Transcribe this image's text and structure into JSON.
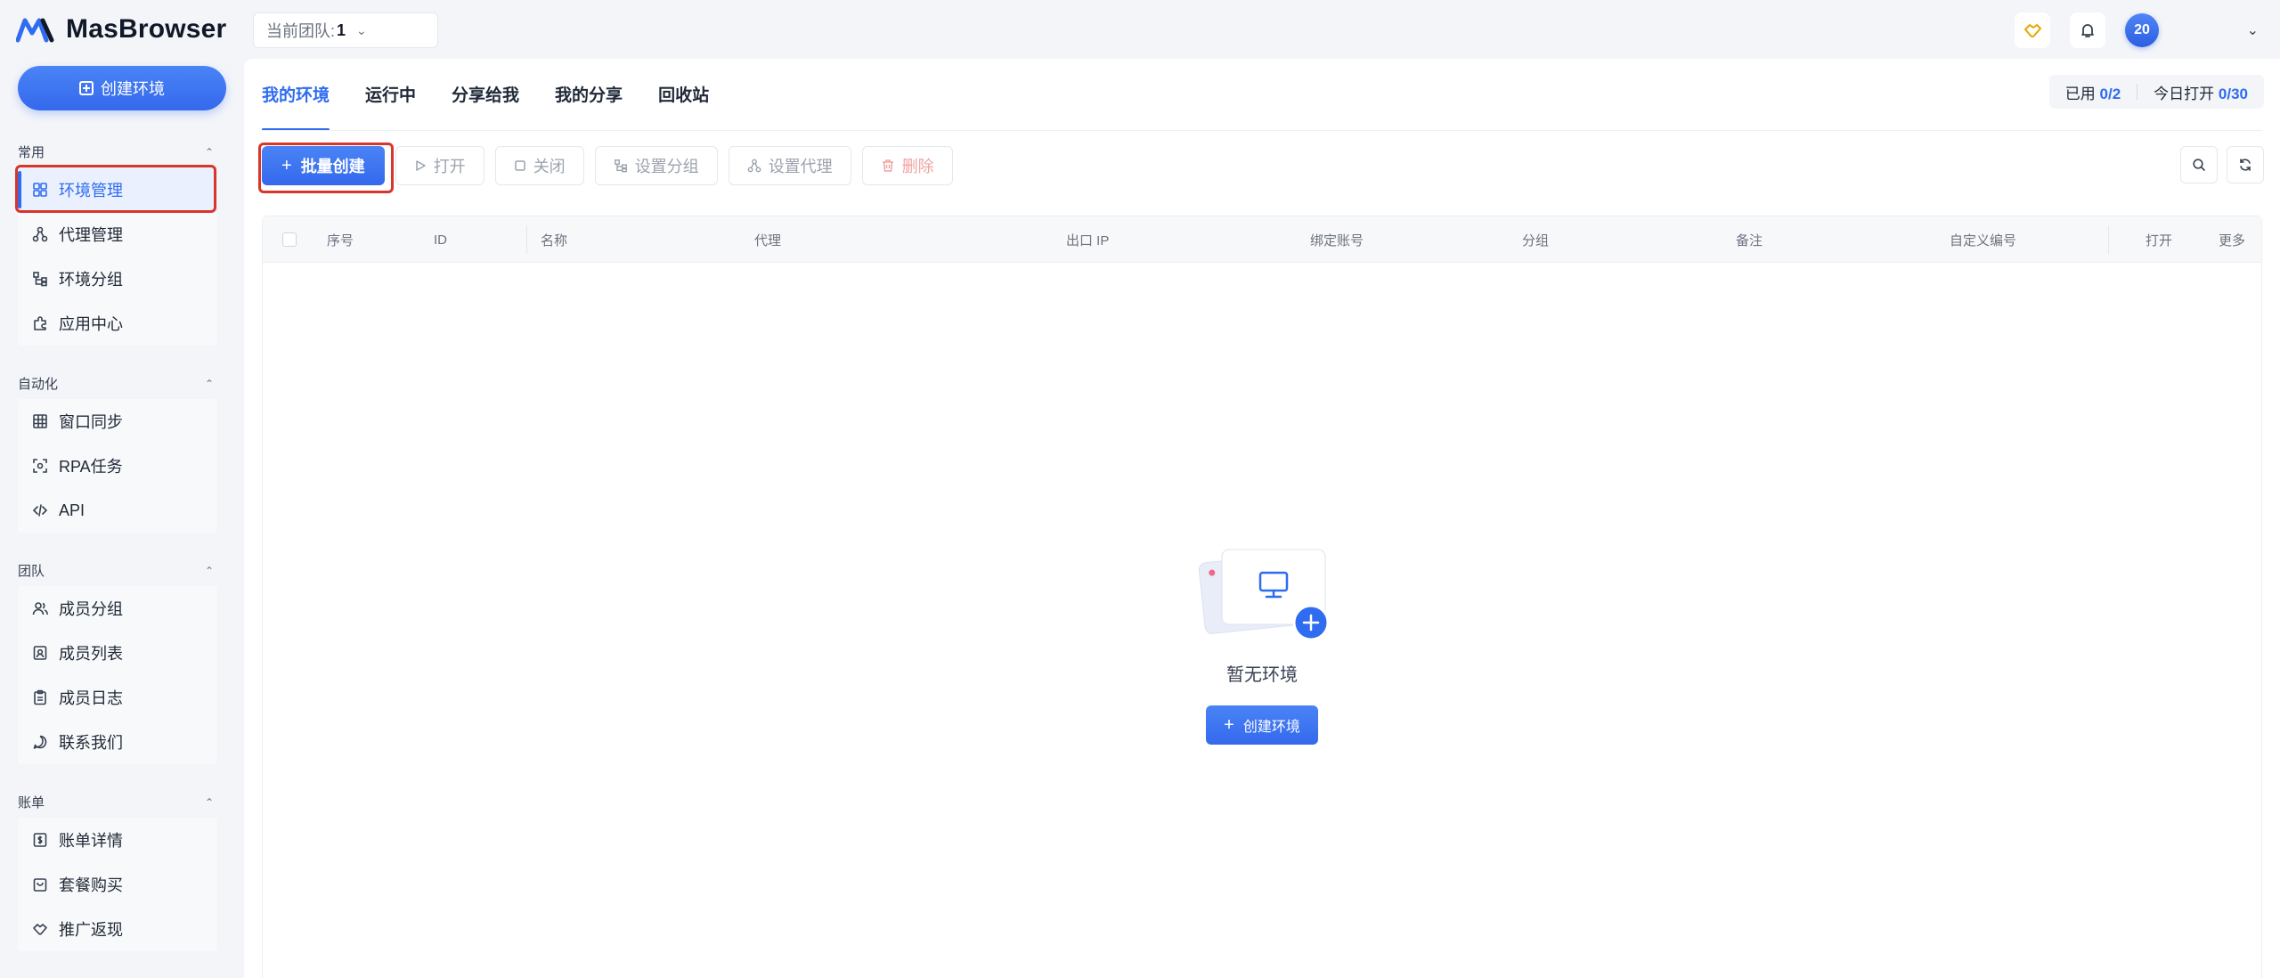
{
  "brand": {
    "name": "MasBrowser"
  },
  "team": {
    "label": "当前团队: ",
    "value": "1"
  },
  "user": {
    "avatar_text": "20"
  },
  "sidebar": {
    "create_label": "创建环境",
    "sections": [
      {
        "title": "常用",
        "items": [
          {
            "label": "环境管理",
            "icon": "grid-icon"
          },
          {
            "label": "代理管理",
            "icon": "network-icon"
          },
          {
            "label": "环境分组",
            "icon": "tree-icon"
          },
          {
            "label": "应用中心",
            "icon": "puzzle-icon"
          }
        ]
      },
      {
        "title": "自动化",
        "items": [
          {
            "label": "窗口同步",
            "icon": "table-icon"
          },
          {
            "label": "RPA任务",
            "icon": "scan-icon"
          },
          {
            "label": "API",
            "icon": "code-icon"
          }
        ]
      },
      {
        "title": "团队",
        "items": [
          {
            "label": "成员分组",
            "icon": "users-icon"
          },
          {
            "label": "成员列表",
            "icon": "contact-icon"
          },
          {
            "label": "成员日志",
            "icon": "clipboard-icon"
          },
          {
            "label": "联系我们",
            "icon": "chat-icon"
          }
        ]
      },
      {
        "title": "账单",
        "items": [
          {
            "label": "账单详情",
            "icon": "dollar-icon"
          },
          {
            "label": "套餐购买",
            "icon": "bag-icon"
          },
          {
            "label": "推广返现",
            "icon": "handshake-icon"
          }
        ]
      }
    ]
  },
  "tabs": [
    "我的环境",
    "运行中",
    "分享给我",
    "我的分享",
    "回收站"
  ],
  "usage": {
    "used_label": "已用",
    "used_value": "0/2",
    "today_label": "今日打开",
    "today_value": "0/30"
  },
  "toolbar": {
    "batch_create": "批量创建",
    "open": "打开",
    "close": "关闭",
    "set_group": "设置分组",
    "set_proxy": "设置代理",
    "delete": "删除"
  },
  "table": {
    "columns": [
      "序号",
      "ID",
      "名称",
      "代理",
      "出口 IP",
      "绑定账号",
      "分组",
      "备注",
      "自定义编号",
      "打开",
      "更多"
    ]
  },
  "empty": {
    "title": "暂无环境",
    "button": "创建环境"
  },
  "colors": {
    "primary": "#2f6cf0",
    "highlight": "#d9362b"
  }
}
